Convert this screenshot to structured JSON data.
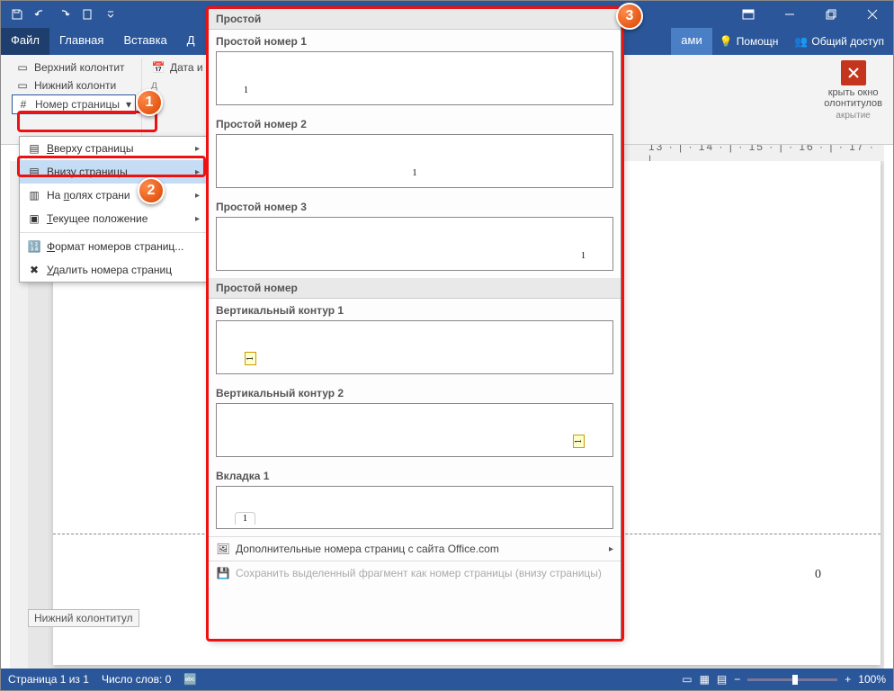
{
  "titlebar": {
    "center": ""
  },
  "winctrls": {
    "ribbon_display": "Параметры отображения ленты",
    "minimize": "Свернуть",
    "restore": "Развернуть",
    "close": "Закрыть"
  },
  "tabs": {
    "file": "Файл",
    "home": "Главная",
    "insert": "Вставка",
    "d": "Д",
    "ctx": "ами",
    "tell": "Помощн",
    "share": "Общий доступ"
  },
  "ribbon": {
    "top_header": "Верхний колонтит",
    "bottom_header": "Нижний колонти",
    "page_number": "Номер страницы",
    "datetime": "Дата и время",
    "d2": "д",
    "close_hf": "крыть окно",
    "close_hf2": "олонтитулов",
    "close_grp": "акрытие"
  },
  "menu": {
    "top": "Вверху страницы",
    "bottom": "Внизу страницы",
    "margins": "На полях страни",
    "current": "Текущее положение",
    "format": "Формат номеров страниц...",
    "remove": "Удалить номера страниц"
  },
  "gallery": {
    "cat1": "Простой",
    "p1": "Простой номер 1",
    "p2": "Простой номер 2",
    "p3": "Простой номер 3",
    "cat2": "Простой номер",
    "v1": "Вертикальный контур 1",
    "v2": "Вертикальный контур 2",
    "v3": "Вкладка 1",
    "opt1": "Дополнительные номера страниц с сайта Office.com",
    "opt2": "Сохранить выделенный фрагмент как номер страницы (внизу страницы)"
  },
  "footlabel": "Нижний колонтитул",
  "pagenum": "0",
  "ruler": "13 · | · 14 · | · 15 · | · 16 · | · 17 · |",
  "statusbar": {
    "page": "Страница 1 из 1",
    "words": "Число слов: 0",
    "zoom": "100%"
  },
  "callouts": {
    "c1": "1",
    "c2": "2",
    "c3": "3"
  }
}
